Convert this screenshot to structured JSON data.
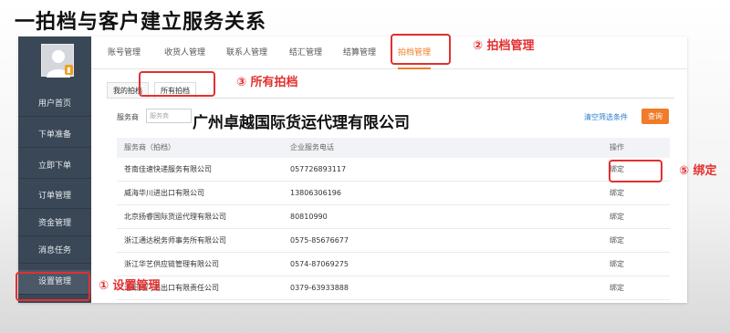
{
  "slide_title": "一拍档与客户建立服务关系",
  "sidebar": {
    "items": [
      {
        "label": "用户首页"
      },
      {
        "label": "下单准备"
      },
      {
        "label": "立即下单"
      },
      {
        "label": "订单管理"
      },
      {
        "label": "资金管理"
      },
      {
        "label": "消息任务"
      },
      {
        "label": "设置管理"
      }
    ]
  },
  "top_tabs": [
    {
      "label": "账号管理"
    },
    {
      "label": "收货人管理"
    },
    {
      "label": "联系人管理"
    },
    {
      "label": "结汇管理"
    },
    {
      "label": "结算管理"
    },
    {
      "label": "拍档管理"
    }
  ],
  "sub_tabs": [
    {
      "label": "我的拍档"
    },
    {
      "label": "所有拍档"
    }
  ],
  "filter": {
    "label": "服务商",
    "placeholder": "服务商",
    "clear_label": "清空筛选条件",
    "query_label": "查询"
  },
  "overlay_company": "广州卓越国际货运代理有限公司",
  "table": {
    "headers": [
      "服务商（拍档）",
      "企业服务电话",
      "操作"
    ],
    "rows": [
      {
        "name": "苍南佳速快递服务有限公司",
        "phone": "057726893117",
        "action": "绑定"
      },
      {
        "name": "威海华川进出口有限公司",
        "phone": "13806306196",
        "action": "绑定"
      },
      {
        "name": "北京扬睿国际货运代理有限公司",
        "phone": "80810990",
        "action": "绑定"
      },
      {
        "name": "浙江通达税务师事务所有限公司",
        "phone": "0575-85676677",
        "action": "绑定"
      },
      {
        "name": "浙江华艺供应链管理有限公司",
        "phone": "0574-87069275",
        "action": "绑定"
      },
      {
        "name": "洛阳博门进出口有限责任公司",
        "phone": "0379-63933888",
        "action": "绑定"
      }
    ]
  },
  "annotations": {
    "step1": "① 设置管理",
    "step2": "② 拍档管理",
    "step3": "③ 所有拍档",
    "step5": "⑤ 绑定"
  },
  "colors": {
    "accent": "#f07b28",
    "sidebar": "#3a4756",
    "annotation": "#e23030",
    "link": "#2a7ccb"
  }
}
